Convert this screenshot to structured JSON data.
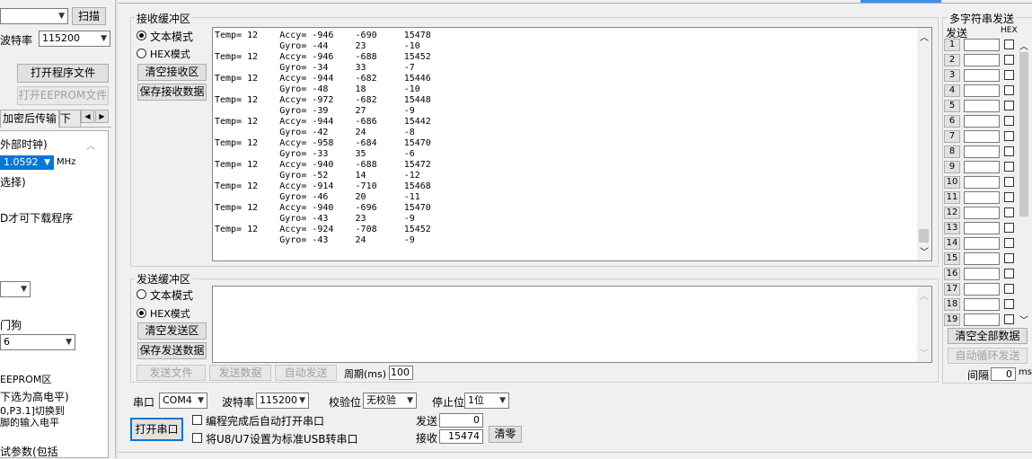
{
  "left_panel": {
    "port_select": "",
    "scan_btn": "扫描",
    "baud_label": "波特率",
    "baud_value": "115200",
    "open_program_btn": "打开程序文件",
    "open_eeprom_btn": "打开EEPROM文件",
    "tab_encrypt": "加密后传输",
    "tab_download": "下载",
    "opt_ext_clock": "外部时钟)",
    "freq_value": "1.0592",
    "freq_unit": "MHz",
    "opt_select": "选择)",
    "opt_download_note": "D才可下载程序",
    "watchdog": "门狗",
    "wd_value": "6",
    "eeprom_area": "EEPROM区",
    "note_high": "下选为高电平)",
    "note_p3": "0,P3.1]切换到",
    "note_input": "脚的输入电平",
    "note_params": "试参数(包括"
  },
  "recv": {
    "title": "接收缓冲区",
    "mode_text": "文本模式",
    "mode_hex": "HEX模式",
    "clear_btn": "清空接收区",
    "save_btn": "保存接收数据",
    "lines": [
      "Temp= 12    Accy= -946    -690     15478",
      "            Gyro= -44     23       -10",
      "Temp= 12    Accy= -946    -688     15452",
      "            Gyro= -34     33       -7",
      "Temp= 12    Accy= -944    -682     15446",
      "            Gyro= -48     18       -10",
      "Temp= 12    Accy= -972    -682     15448",
      "            Gyro= -39     27       -9",
      "Temp= 12    Accy= -944    -686     15442",
      "            Gyro= -42     24       -8",
      "Temp= 12    Accy= -958    -684     15470",
      "            Gyro= -33     35       -6",
      "Temp= 12    Accy= -940    -688     15472",
      "            Gyro= -52     14       -12",
      "Temp= 12    Accy= -914    -710     15468",
      "            Gyro= -46     20       -11",
      "Temp= 12    Accy= -940    -696     15470",
      "            Gyro= -43     23       -9",
      "Temp= 12    Accy= -924    -708     15452",
      "            Gyro= -43     24       -9"
    ]
  },
  "send": {
    "title": "发送缓冲区",
    "mode_text": "文本模式",
    "mode_hex": "HEX模式",
    "clear_btn": "清空发送区",
    "save_btn": "保存发送数据",
    "send_file_btn": "发送文件",
    "send_data_btn": "发送数据",
    "auto_send_btn": "自动发送",
    "period_label": "周期(ms)",
    "period_value": "100"
  },
  "serial": {
    "port_label": "串口",
    "port_value": "COM4",
    "baud_label": "波特率",
    "baud_value": "115200",
    "parity_label": "校验位",
    "parity_value": "无校验",
    "stop_label": "停止位",
    "stop_value": "1位",
    "open_btn": "打开串口",
    "chk_auto_open": "编程完成后自动打开串口",
    "chk_usb": "将U8/U7设置为标准USB转串口",
    "send_label": "发送",
    "send_count": "0",
    "recv_label": "接收",
    "recv_count": "15474",
    "clear_count_btn": "清零"
  },
  "multi": {
    "title": "多字符串发送",
    "col_send": "发送",
    "col_hex": "HEX",
    "rows": [
      "1",
      "2",
      "3",
      "4",
      "5",
      "6",
      "7",
      "8",
      "9",
      "10",
      "11",
      "12",
      "13",
      "14",
      "15",
      "16",
      "17",
      "18",
      "19"
    ],
    "clear_all_btn": "清空全部数据",
    "auto_loop_btn": "自动循环发送",
    "interval_label": "间隔",
    "interval_value": "0",
    "interval_unit": "ms"
  }
}
